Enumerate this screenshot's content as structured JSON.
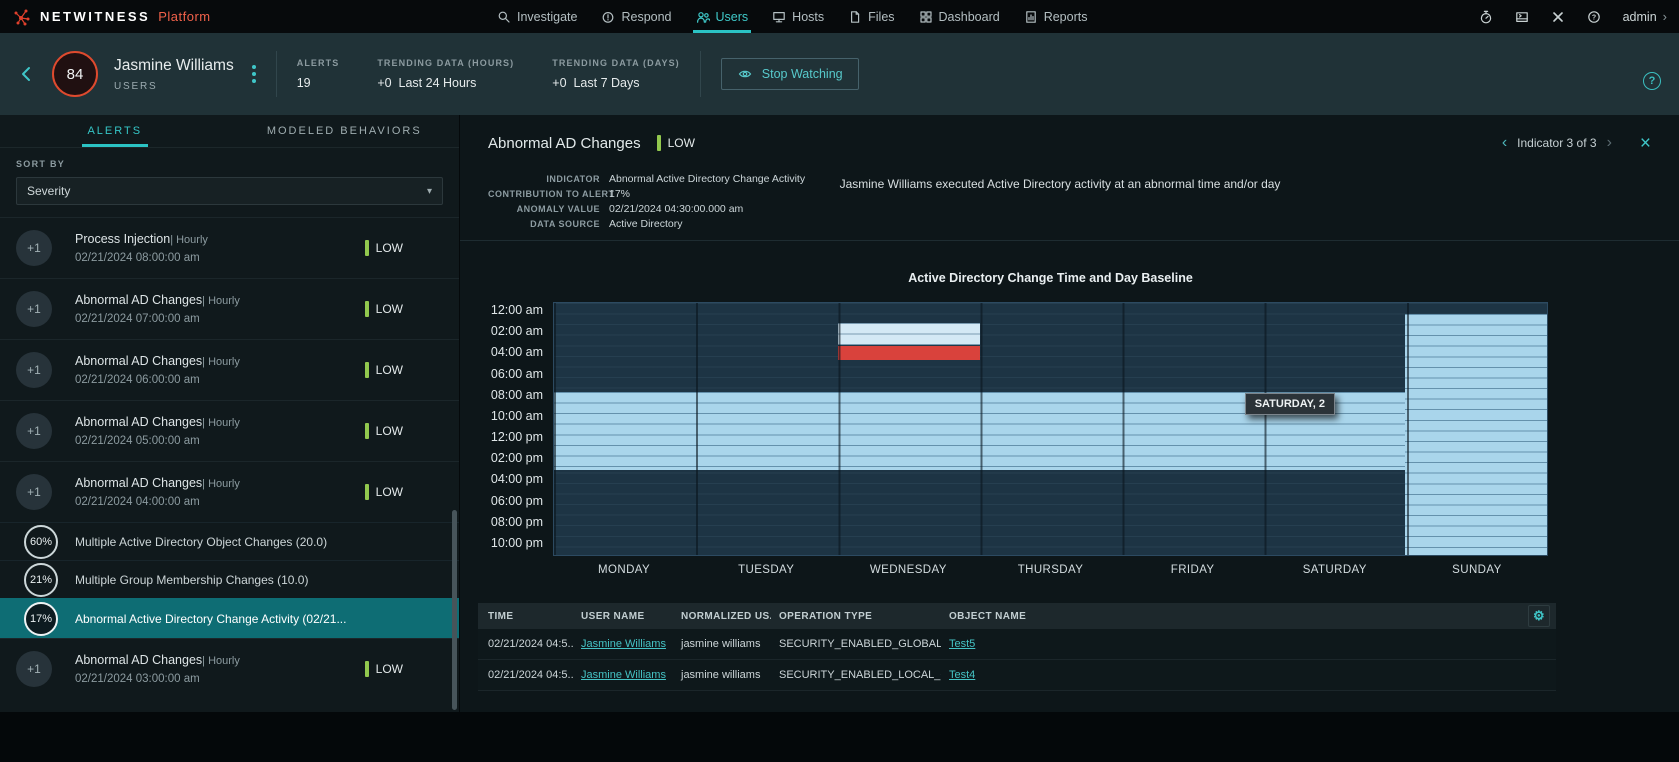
{
  "topnav": {
    "brand_name": "NETWITNESS",
    "brand_suffix": "Platform",
    "items": [
      {
        "label": "Investigate",
        "icon": "investigate-icon",
        "active": false
      },
      {
        "label": "Respond",
        "icon": "respond-icon",
        "active": false
      },
      {
        "label": "Users",
        "icon": "users-icon",
        "active": true
      },
      {
        "label": "Hosts",
        "icon": "hosts-icon",
        "active": false
      },
      {
        "label": "Files",
        "icon": "files-icon",
        "active": false
      },
      {
        "label": "Dashboard",
        "icon": "dashboard-icon",
        "active": false
      },
      {
        "label": "Reports",
        "icon": "reports-icon",
        "active": false
      }
    ],
    "right_icons": [
      "timer-icon",
      "console-icon",
      "tools-icon",
      "help-icon"
    ],
    "user_label": "admin",
    "user_chevron": "›"
  },
  "header": {
    "score_badge": "84",
    "title": "Jasmine Williams",
    "subtitle": "USERS",
    "stats": [
      {
        "label": "ALERTS",
        "value": "19"
      },
      {
        "label": "TRENDING DATA (HOURS)",
        "value": "+0  Last 24 Hours"
      },
      {
        "label": "TRENDING DATA (DAYS)",
        "value": "+0  Last 7 Days"
      }
    ],
    "watch_button_label": "Stop Watching"
  },
  "sidebar": {
    "tabs": [
      {
        "label": "ALERTS",
        "active": true
      },
      {
        "label": "MODELED BEHAVIORS",
        "active": false
      }
    ],
    "sort_by_label": "SORT BY",
    "sort_value": "Severity",
    "items": [
      {
        "type": "alert",
        "badge": "+1",
        "title": "Process Injection",
        "freq": "| Hourly",
        "date": "02/21/2024 08:00:00 am",
        "severity": "LOW"
      },
      {
        "type": "alert",
        "badge": "+1",
        "title": "Abnormal AD Changes",
        "freq": "| Hourly",
        "date": "02/21/2024 07:00:00 am",
        "severity": "LOW"
      },
      {
        "type": "alert",
        "badge": "+1",
        "title": "Abnormal AD Changes",
        "freq": "| Hourly",
        "date": "02/21/2024 06:00:00 am",
        "severity": "LOW"
      },
      {
        "type": "alert",
        "badge": "+1",
        "title": "Abnormal AD Changes",
        "freq": "| Hourly",
        "date": "02/21/2024 05:00:00 am",
        "severity": "LOW"
      },
      {
        "type": "alert",
        "badge": "+1",
        "title": "Abnormal AD Changes",
        "freq": "| Hourly",
        "date": "02/21/2024 04:00:00 am",
        "severity": "LOW"
      },
      {
        "type": "indicator",
        "pct": "60%",
        "label": "Multiple Active Directory Object Changes (20.0)",
        "selected": false
      },
      {
        "type": "indicator",
        "pct": "21%",
        "label": "Multiple Group Membership Changes (10.0)",
        "selected": false
      },
      {
        "type": "indicator",
        "pct": "17%",
        "label": "Abnormal Active Directory Change Activity (02/21...",
        "selected": true
      },
      {
        "type": "alert",
        "badge": "+1",
        "title": "Abnormal AD Changes",
        "freq": "| Hourly",
        "date": "02/21/2024 03:00:00 am",
        "severity": "LOW"
      }
    ]
  },
  "detail": {
    "title": "Abnormal AD Changes",
    "severity": "LOW",
    "pager_label": "Indicator 3 of 3",
    "fields": [
      {
        "label": "INDICATOR",
        "value": "Abnormal Active Directory Change Activity"
      },
      {
        "label": "CONTRIBUTION TO ALERT",
        "value": "17%"
      },
      {
        "label": "ANOMALY VALUE",
        "value": "02/21/2024 04:30:00.000 am"
      },
      {
        "label": "DATA SOURCE",
        "value": "Active Directory"
      }
    ],
    "description": "Jasmine Williams executed Active Directory activity at an abnormal time and/or day"
  },
  "chart_data": {
    "type": "heatmap",
    "title": "Active Directory Change Time and Day Baseline",
    "x_categories": [
      "MONDAY",
      "TUESDAY",
      "WEDNESDAY",
      "THURSDAY",
      "FRIDAY",
      "SATURDAY",
      "SUNDAY"
    ],
    "y_ticks": [
      "12:00 am",
      "02:00 am",
      "04:00 am",
      "06:00 am",
      "08:00 am",
      "10:00 am",
      "12:00 pm",
      "02:00 pm",
      "04:00 pm",
      "06:00 pm",
      "08:00 pm",
      "10:00 pm"
    ],
    "hours_total": 24,
    "colors": {
      "baseline": "#a9d5eb",
      "baseline_light": "#d4e9f5",
      "anomaly": "#d9423c",
      "plot_bg": "#1d3444"
    },
    "regions": [
      {
        "name": "weekday-baseline-block",
        "day_start": 0,
        "day_end": 6,
        "hour_start": 8.5,
        "hour_end": 15.9,
        "color": "baseline",
        "striped": true
      },
      {
        "name": "sunday-baseline-block",
        "day_start": 6,
        "day_end": 7,
        "hour_start": 1.0,
        "hour_end": 24,
        "color": "baseline",
        "striped": true
      },
      {
        "name": "wednesday-baseline-band",
        "day_start": 2,
        "day_end": 3,
        "hour_start": 1.9,
        "hour_end": 4.0,
        "color": "baseline_light",
        "striped": true
      },
      {
        "name": "wednesday-anomaly-band",
        "day_start": 2,
        "day_end": 3,
        "hour_start": 4.05,
        "hour_end": 5.4,
        "color": "anomaly",
        "striped": false
      }
    ],
    "tooltip": {
      "text": "SATURDAY, 2",
      "day_index": 5,
      "hour": 8.5
    }
  },
  "table": {
    "headers": [
      "TIME",
      "USER NAME",
      "NORMALIZED US...",
      "OPERATION TYPE",
      "OBJECT NAME"
    ],
    "rows": [
      {
        "time": "02/21/2024 04:5...",
        "user_name": "Jasmine Williams",
        "normalized": "jasmine williams",
        "operation": "SECURITY_ENABLED_GLOBAL_G...",
        "object_name": "Test5"
      },
      {
        "time": "02/21/2024 04:5...",
        "user_name": "Jasmine Williams",
        "normalized": "jasmine williams",
        "operation": "SECURITY_ENABLED_LOCAL_GR...",
        "object_name": "Test4"
      }
    ]
  }
}
